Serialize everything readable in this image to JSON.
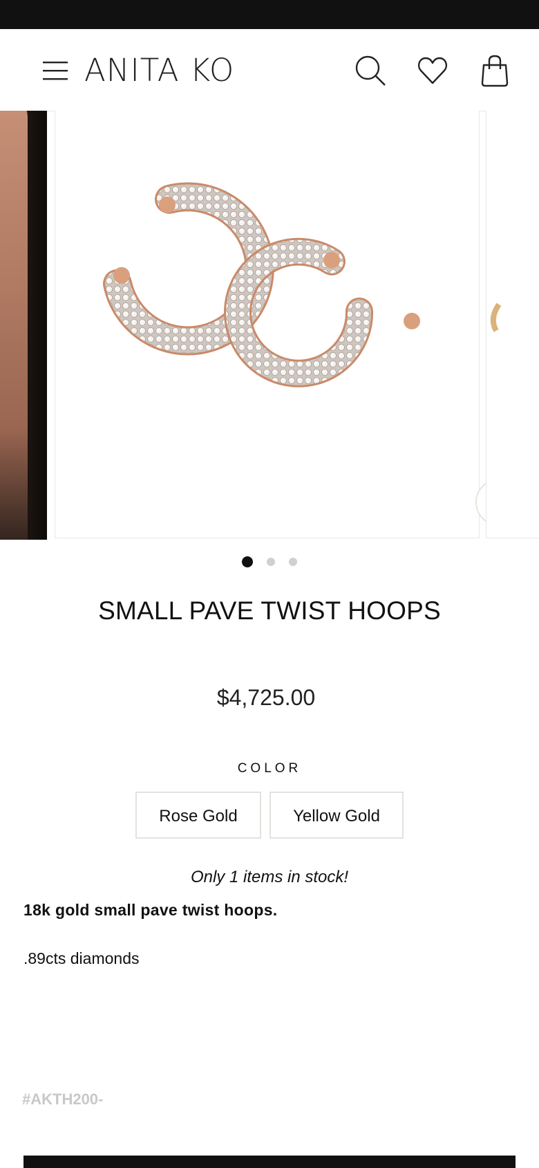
{
  "header": {
    "logo": "ANITA KO",
    "icons": [
      "menu-icon",
      "search-icon",
      "heart-icon",
      "bag-icon"
    ]
  },
  "gallery": {
    "slide_count": 3,
    "active_slide": 1,
    "zoom_icon": "zoom-icon"
  },
  "product": {
    "title": "SMALL PAVE TWIST HOOPS",
    "price": "$4,725.00",
    "color_label": "COLOR",
    "color_options": [
      "Rose Gold",
      "Yellow Gold"
    ],
    "stock_message": "Only 1 items in stock!",
    "description_bold": "18k gold small pave twist hoops.",
    "diamonds": ".89cts diamonds",
    "sku": "#AKTH200-"
  },
  "colors": {
    "topbar": "#111111",
    "rose_gold_metal": "#d9a07e",
    "inactive_dot": "#d0d0d0",
    "sku_text": "#c8c8c8"
  }
}
